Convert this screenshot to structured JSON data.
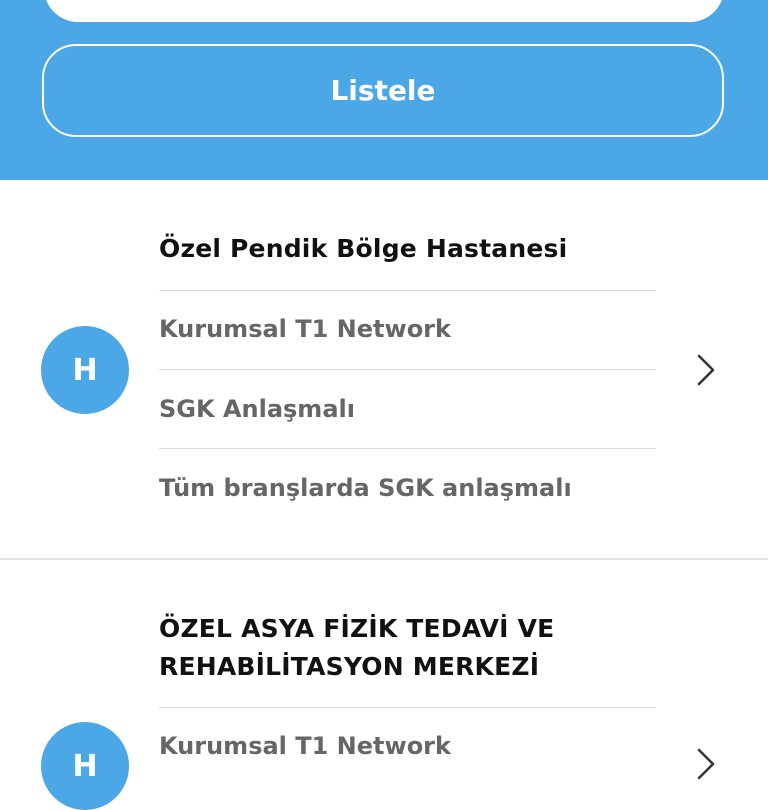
{
  "header": {
    "list_button_label": "Listele"
  },
  "results": [
    {
      "avatar_letter": "H",
      "name": "Özel Pendik Bölge Hastanesi",
      "network": "Kurumsal T1 Network",
      "sgk_status": "SGK Anlaşmalı",
      "sgk_detail": "Tüm branşlarda SGK anlaşmalı"
    },
    {
      "avatar_letter": "H",
      "name": "ÖZEL ASYA FİZİK TEDAVİ VE REHABİLİTASYON MERKEZİ",
      "network": "Kurumsal T1 Network"
    }
  ],
  "colors": {
    "accent": "#4ca7e6",
    "title_text": "#111111",
    "secondary_text": "#666666"
  },
  "icons": {
    "chevron": "chevron-right-icon"
  }
}
